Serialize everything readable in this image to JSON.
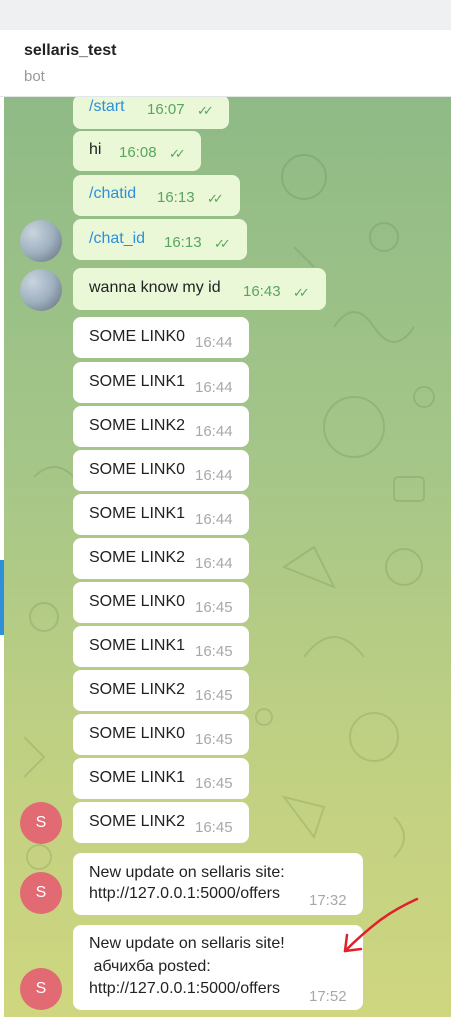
{
  "chat": {
    "title": "sellaris_test",
    "status": "bot"
  },
  "messages": [
    {
      "text": "/start",
      "time": "16:07"
    },
    {
      "text": "hi",
      "time": "16:08"
    },
    {
      "text": "/chatid",
      "time": "16:13"
    },
    {
      "text": "/chat_id",
      "time": "16:13"
    },
    {
      "text": "wanna know my id",
      "time": "16:43"
    },
    {
      "text": "SOME LINK0",
      "time": "16:44"
    },
    {
      "text": "SOME LINK1",
      "time": "16:44"
    },
    {
      "text": "SOME LINK2",
      "time": "16:44"
    },
    {
      "text": "SOME LINK0",
      "time": "16:44"
    },
    {
      "text": "SOME LINK1",
      "time": "16:44"
    },
    {
      "text": "SOME LINK2",
      "time": "16:44"
    },
    {
      "text": "SOME LINK0",
      "time": "16:45"
    },
    {
      "text": "SOME LINK1",
      "time": "16:45"
    },
    {
      "text": "SOME LINK2",
      "time": "16:45"
    },
    {
      "text": "SOME LINK0",
      "time": "16:45"
    },
    {
      "text": "SOME LINK1",
      "time": "16:45"
    },
    {
      "text": "SOME LINK2",
      "time": "16:45"
    },
    {
      "line1": "New update on sellaris site:",
      "link": "http://127.0.0.1:5000/offers",
      "time": "17:32"
    },
    {
      "line1": "New update on sellaris site!",
      "line2": " абчихба posted:",
      "link": "http://127.0.0.1:5000/offers",
      "time": "17:52"
    }
  ],
  "bot_avatar_letter": "S",
  "colors": {
    "accent": "#2f8fd8",
    "outgoing_bubble": "#eaf8d8",
    "incoming_bubble": "#ffffff",
    "bot_avatar": "#e16a73",
    "annotation_arrow": "#e0202a"
  },
  "icons": {
    "read_status": "double-check-icon",
    "annotation": "red-arrow-icon"
  }
}
